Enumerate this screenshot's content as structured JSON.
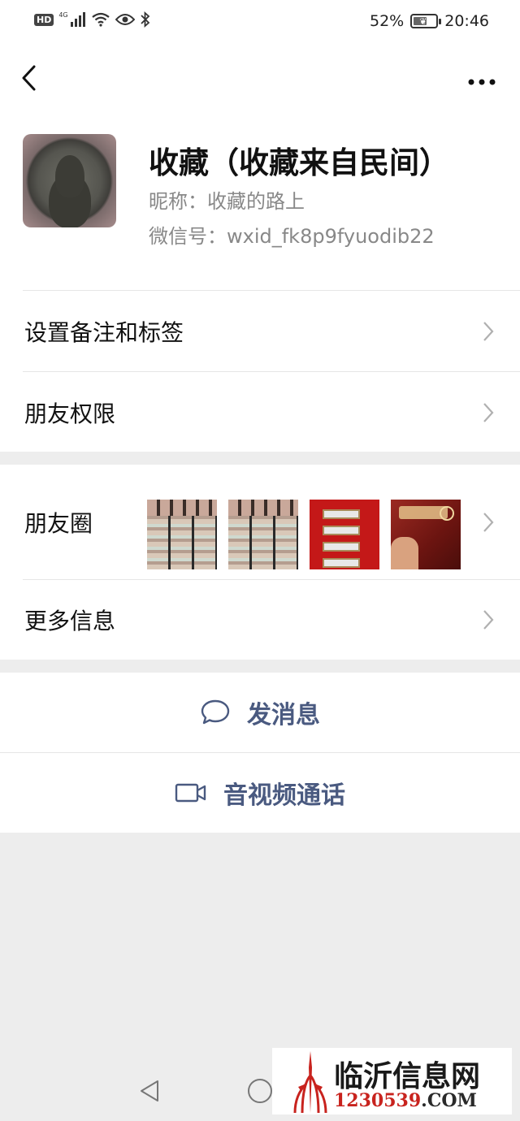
{
  "status_bar": {
    "hd_label": "HD",
    "signal_label": "4G",
    "battery_text": "52%",
    "battery_level": 0.52,
    "time": "20:46",
    "icons": [
      "signal-icon",
      "wifi-icon",
      "eye-icon",
      "bluetooth-icon",
      "battery-icon"
    ]
  },
  "nav": {
    "back_icon": "chevron-left-icon",
    "more_icon": "more-dots-icon"
  },
  "profile": {
    "name": "收藏（收藏来自民间）",
    "nickname": "昵称：收藏的路上",
    "wechat_id": "微信号：wxid_fk8p9fyuodib22"
  },
  "rows": {
    "remark_tags": "设置备注和标签",
    "friend_permissions": "朋友权限",
    "moments": "朋友圈",
    "more_info": "更多信息"
  },
  "actions": {
    "send_message": "发消息",
    "video_call": "音视频通话"
  },
  "watermark": {
    "title": "临沂信息网",
    "url_number": "1230539",
    "url_suffix": ".COM"
  },
  "colors": {
    "action_text": "#4a5a80",
    "background": "#ededed",
    "watermark_red": "#c8231e"
  }
}
